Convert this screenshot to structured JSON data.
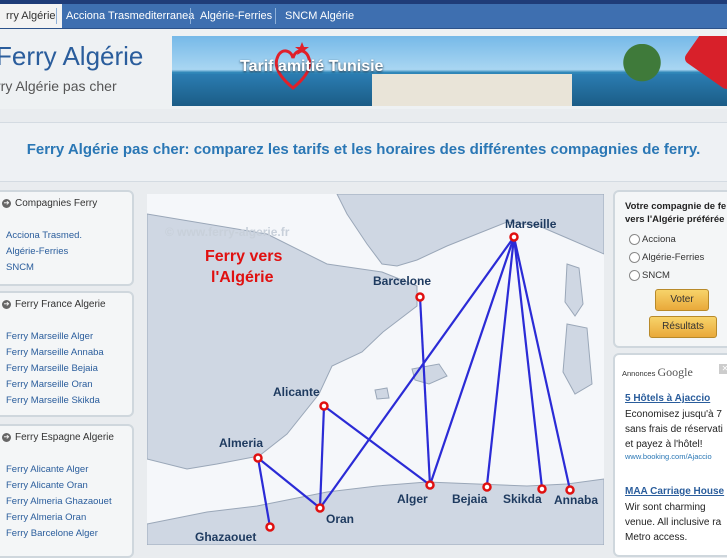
{
  "nav": {
    "items": [
      {
        "label": "rry Algérie"
      },
      {
        "label": "Acciona Trasmediterranea"
      },
      {
        "label": "Algérie-Ferries"
      },
      {
        "label": "SNCM Algérie"
      }
    ]
  },
  "header": {
    "site_title": "Ferry Algérie",
    "site_subtitle": "rry Algérie pas cher",
    "banner_text": "Tarif amitié Tunisie"
  },
  "page_title": "Ferry Algérie pas cher: comparez les tarifs et les horaires des différentes compagnies de ferry.",
  "sidebar": {
    "boxes": [
      {
        "title": "Compagnies Ferry",
        "links": [
          "Acciona Trasmed.",
          "Algérie-Ferries",
          "SNCM"
        ]
      },
      {
        "title": "Ferry France Algerie",
        "links": [
          "Ferry Marseille Alger",
          "Ferry Marseille Annaba",
          "Ferry Marseille Bejaia",
          "Ferry Marseille Oran",
          "Ferry Marseille Skikda"
        ]
      },
      {
        "title": "Ferry Espagne Algerie",
        "links": [
          "Ferry Alicante Alger",
          "Ferry Alicante Oran",
          "Ferry Almeria Ghazaouet",
          "Ferry Almeria Oran",
          "Ferry Barcelone Alger"
        ]
      }
    ]
  },
  "map": {
    "watermark": "© www.ferry-algerie.fr",
    "title_line1": "Ferry vers",
    "title_line2": "l'Algérie",
    "cities": {
      "marseille": "Marseille",
      "barcelone": "Barcelone",
      "alicante": "Alicante",
      "almeria": "Almeria",
      "oran": "Oran",
      "ghazaouet": "Ghazaouet",
      "alger": "Alger",
      "bejaia": "Bejaia",
      "skikda": "Skikda",
      "annaba": "Annaba"
    },
    "colors": {
      "route": "#2b2bd6",
      "port": "#e01010",
      "sea": "#f5f7fa",
      "land": "#cfd7e3"
    }
  },
  "poll": {
    "question_line1": "Votre compagnie de fe",
    "question_line2": "vers l'Algérie préférée",
    "options": [
      "Acciona",
      "Algérie-Ferries",
      "SNCM"
    ],
    "vote_label": "Voter",
    "results_label": "Résultats"
  },
  "ads": {
    "label": "Annonces",
    "brand": "Google",
    "items": [
      {
        "title": "5 Hôtels à Ajaccio",
        "lines": [
          "Economisez jusqu'à 7",
          "sans frais de réservati",
          "et payez à l'hôtel!"
        ],
        "url": "www.booking.com/Ajaccio"
      },
      {
        "title": "MAA Carriage House",
        "lines": [
          "Wir sont charming",
          "venue. All inclusive ra",
          "Metro access."
        ],
        "url": ""
      }
    ]
  }
}
